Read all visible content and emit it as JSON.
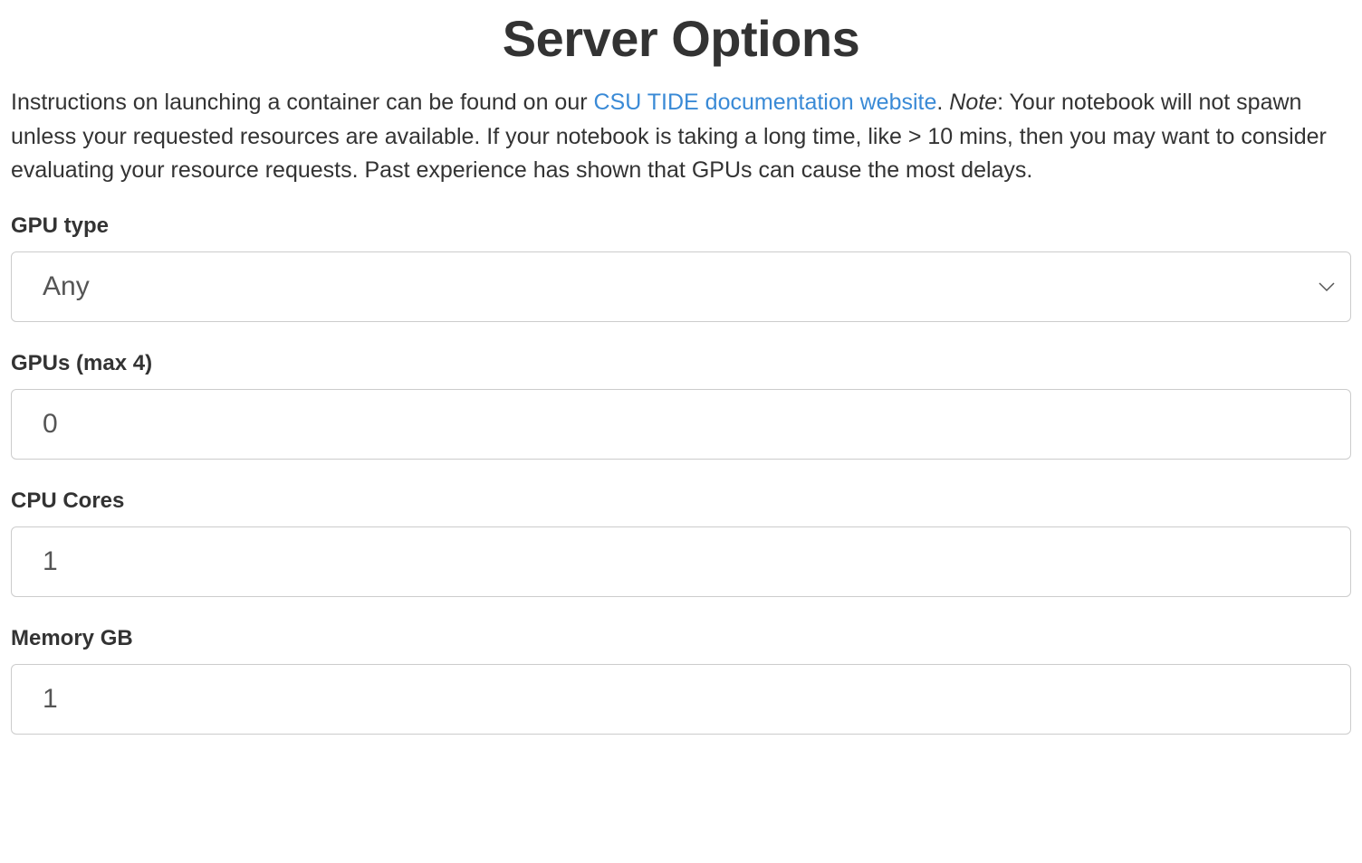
{
  "title": "Server Options",
  "intro": {
    "prefix": "Instructions on launching a container can be found on our ",
    "link_text": "CSU TIDE documentation website",
    "after_link": ". ",
    "note_label": "Note",
    "note_text": ": Your notebook will not spawn unless your requested resources are available. If your notebook is taking a long time, like > 10 mins, then you may want to consider evaluating your resource requests. Past experience has shown that GPUs can cause the most delays."
  },
  "fields": {
    "gpu_type": {
      "label": "GPU type",
      "value": "Any"
    },
    "gpus": {
      "label": "GPUs (max 4)",
      "value": "0"
    },
    "cpu_cores": {
      "label": "CPU Cores",
      "value": "1"
    },
    "memory_gb": {
      "label": "Memory GB",
      "value": "1"
    }
  }
}
